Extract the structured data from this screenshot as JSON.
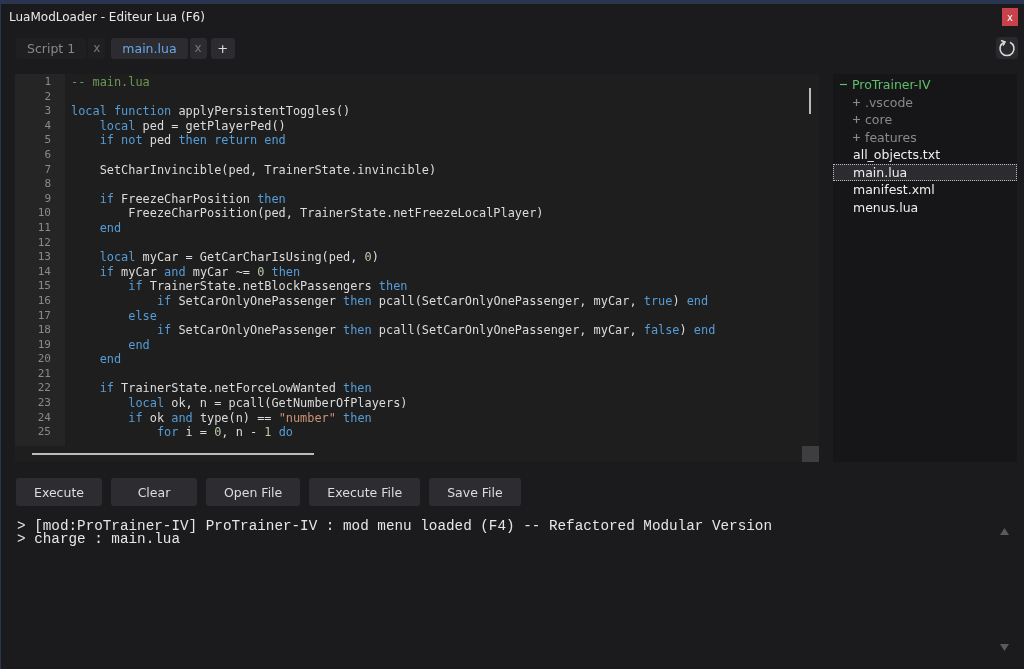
{
  "window": {
    "title": "LuaModLoader - Editeur Lua (F6)",
    "close_label": "x"
  },
  "tabs": [
    {
      "label": "Script 1",
      "close_label": "x",
      "selected": false
    },
    {
      "label": "main.lua",
      "close_label": "x",
      "selected": true
    }
  ],
  "new_tab_label": "+",
  "editor": {
    "lines": [
      {
        "number": "1",
        "segments": [
          {
            "kind": "comment",
            "text": "-- main.lua"
          }
        ]
      },
      {
        "number": "2"
      },
      {
        "number": "3",
        "segments": [
          {
            "kind": "keyword",
            "text": "local function"
          },
          {
            "kind": "plain",
            "text": " applyPersistentToggles()"
          }
        ]
      },
      {
        "number": "4",
        "segments": [
          {
            "kind": "keyword",
            "text": "    local"
          },
          {
            "kind": "plain",
            "text": " ped = getPlayerPed()"
          }
        ]
      },
      {
        "number": "5",
        "segments": [
          {
            "kind": "keyword",
            "text": "    if not"
          },
          {
            "kind": "plain",
            "text": " ped "
          },
          {
            "kind": "keyword",
            "text": "then return end"
          }
        ]
      },
      {
        "number": "6"
      },
      {
        "number": "7",
        "segments": [
          {
            "kind": "plain",
            "text": "    SetCharInvincible(ped, TrainerState.invincible)"
          }
        ]
      },
      {
        "number": "8"
      },
      {
        "number": "9",
        "segments": [
          {
            "kind": "keyword",
            "text": "    if"
          },
          {
            "kind": "plain",
            "text": " FreezeCharPosition "
          },
          {
            "kind": "keyword",
            "text": "then"
          }
        ]
      },
      {
        "number": "10",
        "segments": [
          {
            "kind": "plain",
            "text": "        FreezeCharPosition(ped, TrainerState.netFreezeLocalPlayer)"
          }
        ]
      },
      {
        "number": "11",
        "segments": [
          {
            "kind": "keyword",
            "text": "    end"
          }
        ]
      },
      {
        "number": "12"
      },
      {
        "number": "13",
        "segments": [
          {
            "kind": "keyword",
            "text": "    local"
          },
          {
            "kind": "plain",
            "text": " myCar = GetCarCharIsUsing(ped, "
          },
          {
            "kind": "number",
            "text": "0"
          },
          {
            "kind": "plain",
            "text": ")"
          }
        ]
      },
      {
        "number": "14",
        "segments": [
          {
            "kind": "keyword",
            "text": "    if"
          },
          {
            "kind": "plain",
            "text": " myCar "
          },
          {
            "kind": "keyword",
            "text": "and"
          },
          {
            "kind": "plain",
            "text": " myCar ~= "
          },
          {
            "kind": "number",
            "text": "0"
          },
          {
            "kind": "keyword",
            "text": " then"
          }
        ]
      },
      {
        "number": "15",
        "segments": [
          {
            "kind": "keyword",
            "text": "        if"
          },
          {
            "kind": "plain",
            "text": " TrainerState.netBlockPassengers "
          },
          {
            "kind": "keyword",
            "text": "then"
          }
        ]
      },
      {
        "number": "16",
        "segments": [
          {
            "kind": "keyword",
            "text": "            if"
          },
          {
            "kind": "plain",
            "text": " SetCarOnlyOnePassenger "
          },
          {
            "kind": "keyword",
            "text": "then"
          },
          {
            "kind": "plain",
            "text": " pcall(SetCarOnlyOnePassenger, myCar, "
          },
          {
            "kind": "keyword",
            "text": "true"
          },
          {
            "kind": "plain",
            "text": ")"
          },
          {
            "kind": "keyword",
            "text": " end"
          }
        ]
      },
      {
        "number": "17",
        "segments": [
          {
            "kind": "keyword",
            "text": "        else"
          }
        ]
      },
      {
        "number": "18",
        "segments": [
          {
            "kind": "keyword",
            "text": "            if"
          },
          {
            "kind": "plain",
            "text": " SetCarOnlyOnePassenger "
          },
          {
            "kind": "keyword",
            "text": "then"
          },
          {
            "kind": "plain",
            "text": " pcall(SetCarOnlyOnePassenger, myCar, "
          },
          {
            "kind": "keyword",
            "text": "false"
          },
          {
            "kind": "plain",
            "text": ")"
          },
          {
            "kind": "keyword",
            "text": " end"
          }
        ]
      },
      {
        "number": "19",
        "segments": [
          {
            "kind": "keyword",
            "text": "        end"
          }
        ]
      },
      {
        "number": "20",
        "segments": [
          {
            "kind": "keyword",
            "text": "    end"
          }
        ]
      },
      {
        "number": "21"
      },
      {
        "number": "22",
        "segments": [
          {
            "kind": "keyword",
            "text": "    if"
          },
          {
            "kind": "plain",
            "text": " TrainerState.netForceLowWanted "
          },
          {
            "kind": "keyword",
            "text": "then"
          }
        ]
      },
      {
        "number": "23",
        "segments": [
          {
            "kind": "keyword",
            "text": "        local"
          },
          {
            "kind": "plain",
            "text": " ok, n = pcall(GetNumberOfPlayers)"
          }
        ]
      },
      {
        "number": "24",
        "segments": [
          {
            "kind": "keyword",
            "text": "        if"
          },
          {
            "kind": "plain",
            "text": " ok "
          },
          {
            "kind": "keyword",
            "text": "and"
          },
          {
            "kind": "plain",
            "text": " type(n) == "
          },
          {
            "kind": "string",
            "text": "\"number\""
          },
          {
            "kind": "keyword",
            "text": " then"
          }
        ]
      },
      {
        "number": "25",
        "segments": [
          {
            "kind": "keyword",
            "text": "            for"
          },
          {
            "kind": "plain",
            "text": " i = "
          },
          {
            "kind": "number",
            "text": "0"
          },
          {
            "kind": "plain",
            "text": ", n - "
          },
          {
            "kind": "number",
            "text": "1"
          },
          {
            "kind": "keyword",
            "text": " do"
          }
        ]
      }
    ]
  },
  "file_tree": [
    {
      "label": "ProTrainer-IV",
      "kind": "folder",
      "expanded": true,
      "selected": false,
      "children": [
        {
          "label": ".vscode",
          "kind": "folder",
          "expanded": false,
          "selected": false
        },
        {
          "label": "core",
          "kind": "folder",
          "expanded": false,
          "selected": false
        },
        {
          "label": "features",
          "kind": "folder",
          "expanded": false,
          "selected": false
        },
        {
          "label": "all_objects.txt",
          "kind": "file",
          "selected": false
        },
        {
          "label": "main.lua",
          "kind": "file",
          "selected": true
        },
        {
          "label": "manifest.xml",
          "kind": "file",
          "selected": false
        },
        {
          "label": "menus.lua",
          "kind": "file",
          "selected": false
        }
      ]
    }
  ],
  "buttons": [
    "Execute",
    "Clear",
    "Open File",
    "Execute File",
    "Save File"
  ],
  "console": {
    "lines": [
      "> [mod:ProTrainer-IV] ProTrainer-IV : mod menu loaded (F4) -- Refactored Modular Version",
      "> charge : main.lua"
    ]
  }
}
